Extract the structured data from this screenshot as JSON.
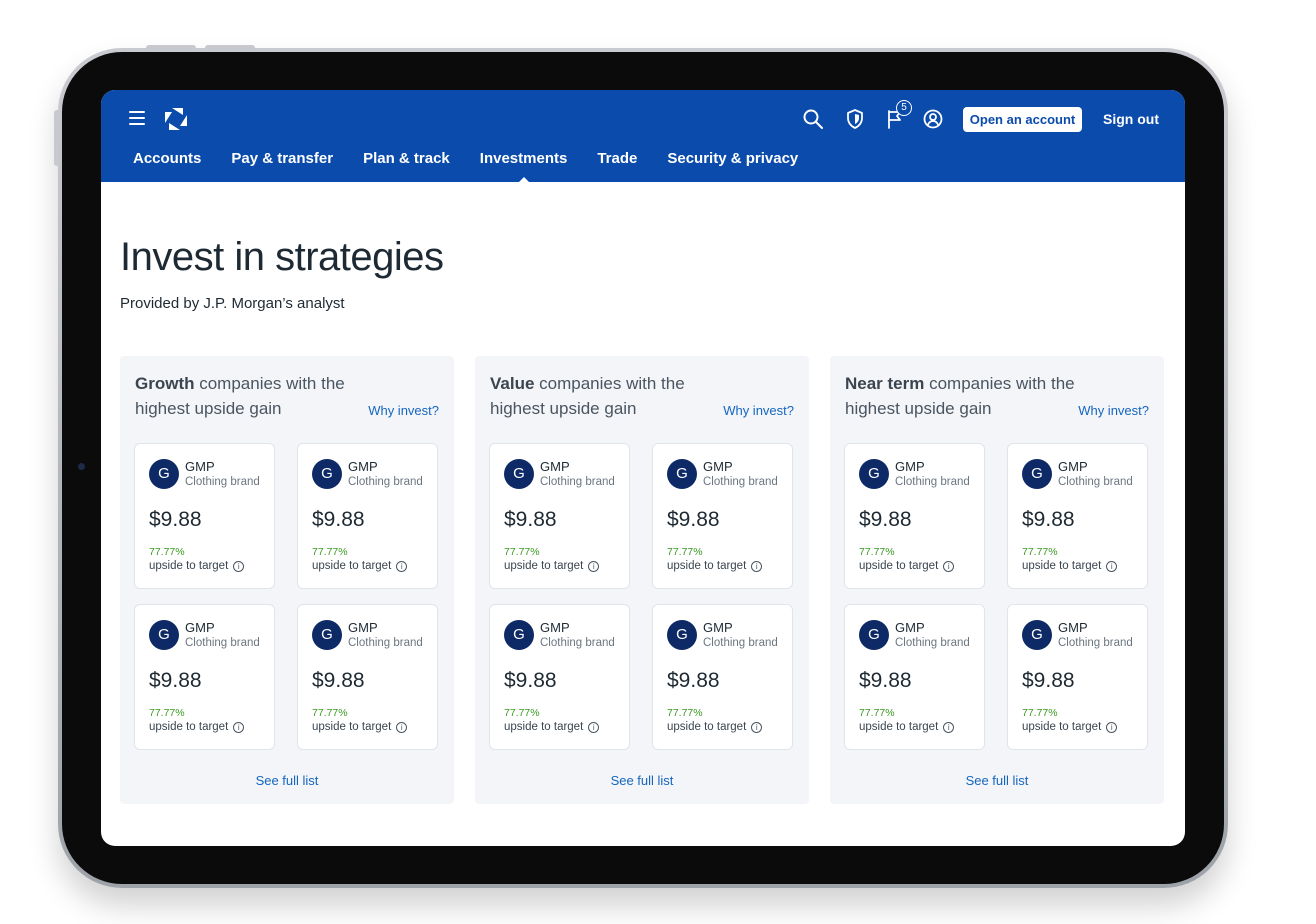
{
  "header": {
    "menu_icon": "hamburger-icon",
    "logo_icon": "bank-octagon-logo",
    "icons": [
      "search-icon",
      "shield-icon",
      "flag-notification-icon",
      "profile-icon"
    ],
    "notification_count": "5",
    "open_account_label": "Open an account",
    "sign_out_label": "Sign out"
  },
  "nav": {
    "items": [
      {
        "label": "Accounts"
      },
      {
        "label": "Pay & transfer"
      },
      {
        "label": "Plan & track"
      },
      {
        "label": "Investments"
      },
      {
        "label": "Trade"
      },
      {
        "label": "Security & privacy"
      }
    ],
    "active": "Investments"
  },
  "page": {
    "title": "Invest in strategies",
    "subtitle": "Provided by J.P. Morgan’s analyst"
  },
  "panels": [
    {
      "strong": "Growth",
      "rest": " companies with the highest upside gain",
      "why_label": "Why invest?",
      "see_full_label": "See full list",
      "cards": [
        {
          "initial": "G",
          "ticker": "GMP",
          "sector": "Clothing brand",
          "price": "$9.88",
          "pct": "77.77%",
          "upside": "upside to target"
        },
        {
          "initial": "G",
          "ticker": "GMP",
          "sector": "Clothing brand",
          "price": "$9.88",
          "pct": "77.77%",
          "upside": "upside to target"
        },
        {
          "initial": "G",
          "ticker": "GMP",
          "sector": "Clothing brand",
          "price": "$9.88",
          "pct": "77.77%",
          "upside": "upside to target"
        },
        {
          "initial": "G",
          "ticker": "GMP",
          "sector": "Clothing brand",
          "price": "$9.88",
          "pct": "77.77%",
          "upside": "upside to target"
        }
      ]
    },
    {
      "strong": "Value",
      "rest": " companies with the highest upside gain",
      "why_label": "Why invest?",
      "see_full_label": "See full list",
      "cards": [
        {
          "initial": "G",
          "ticker": "GMP",
          "sector": "Clothing brand",
          "price": "$9.88",
          "pct": "77.77%",
          "upside": "upside to target"
        },
        {
          "initial": "G",
          "ticker": "GMP",
          "sector": "Clothing brand",
          "price": "$9.88",
          "pct": "77.77%",
          "upside": "upside to target"
        },
        {
          "initial": "G",
          "ticker": "GMP",
          "sector": "Clothing brand",
          "price": "$9.88",
          "pct": "77.77%",
          "upside": "upside to target"
        },
        {
          "initial": "G",
          "ticker": "GMP",
          "sector": "Clothing brand",
          "price": "$9.88",
          "pct": "77.77%",
          "upside": "upside to target"
        }
      ]
    },
    {
      "strong": "Near term",
      "rest": " companies with the highest upside gain",
      "why_label": "Why invest?",
      "see_full_label": "See full list",
      "cards": [
        {
          "initial": "G",
          "ticker": "GMP",
          "sector": "Clothing brand",
          "price": "$9.88",
          "pct": "77.77%",
          "upside": "upside to target"
        },
        {
          "initial": "G",
          "ticker": "GMP",
          "sector": "Clothing brand",
          "price": "$9.88",
          "pct": "77.77%",
          "upside": "upside to target"
        },
        {
          "initial": "G",
          "ticker": "GMP",
          "sector": "Clothing brand",
          "price": "$9.88",
          "pct": "77.77%",
          "upside": "upside to target"
        },
        {
          "initial": "G",
          "ticker": "GMP",
          "sector": "Clothing brand",
          "price": "$9.88",
          "pct": "77.77%",
          "upside": "upside to target"
        }
      ]
    }
  ],
  "colors": {
    "brand_blue": "#0a4bab",
    "avatar_navy": "#0e2a66",
    "link_blue": "#1565c0",
    "positive_green": "#3a9b22",
    "panel_bg": "#f3f5f8"
  }
}
